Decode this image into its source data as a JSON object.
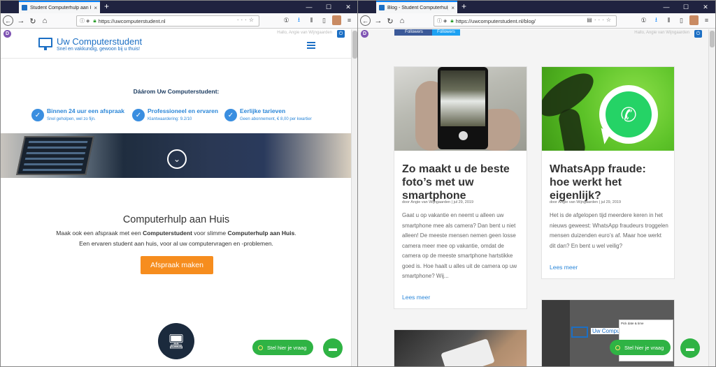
{
  "left_window": {
    "tab_title": "Student Computerhulp aan Hu",
    "tab_close": "×",
    "new_tab": "+",
    "url": "https://uwcomputerstudent.nl",
    "site": {
      "admin_ghost": "Hallo, Angie van Wijngaarden",
      "brand": "Uw Computerstudent",
      "tagline": "Snel en vakkundig, gewoon bij u thuis!",
      "daarom": "Dáárom Uw Computerstudent:",
      "features": [
        {
          "title": "Binnen 24 uur een afspraak",
          "sub": "Snel geholpen, wel zo fijn."
        },
        {
          "title": "Professioneel en ervaren",
          "sub": "Klantwaardering: 9.2/10"
        },
        {
          "title": "Eerlijke tarieven",
          "sub": "Geen abonnement, € 8,00 per kwartier"
        }
      ],
      "section_title": "Computerhulp aan Huis",
      "para_a": "Maak ook een afspraak met een ",
      "para_b": "Computerstudent",
      "para_c": " voor slimme ",
      "para_d": "Computerhulp aan Huis",
      "para_e": ".",
      "para_line2": "Een ervaren student aan huis, voor al uw computervragen en -problemen.",
      "cta": "Afspraak maken",
      "chat": "Stel hier je vraag"
    }
  },
  "right_window": {
    "tab_title": "Blog - Student Computerhulp",
    "tab_close": "×",
    "new_tab": "+",
    "url": "https://uwcomputerstudent.nl/blog/",
    "site": {
      "admin_ghost": "Hallo, Angie van Wijngaarden",
      "follow_1": "Followers",
      "follow_2": "Followers",
      "posts": [
        {
          "title": "Zo maakt u de beste foto’s met uw smartphone",
          "meta": "door Angie van Wijngaarden | jul 29, 2019",
          "excerpt": "Gaat u op vakantie en neemt u alleen uw smartphone mee als camera? Dan bent u niet alleen! De meeste mensen nemen geen losse camera meer mee op vakantie, omdat de camera op de meeste smartphone hartstikke goed is. Hoe haalt u alles uit de camera op uw smartphone? Wij...",
          "more": "Lees meer"
        },
        {
          "title": "WhatsApp fraude: hoe werkt het eigenlijk?",
          "meta": "door Angie van Wijngaarden | jul 29, 2019",
          "excerpt": "Het is de afgelopen tijd meerdere keren in het nieuws geweest: WhatsApp fraudeurs troggelen mensen duizenden euro’s af. Maar hoe werkt dit dan? En bent u wel veilig?",
          "more": "Lees meer"
        }
      ],
      "thumb_brand": "Uw Computerstudent",
      "thumb_dialog": "Pick date & time",
      "chat": "Stel hier je vraag"
    }
  },
  "colors": {
    "brand_blue": "#1c6fc4",
    "cta_orange": "#f68d1e",
    "chat_green": "#2fb344",
    "tabbar": "#202340"
  }
}
